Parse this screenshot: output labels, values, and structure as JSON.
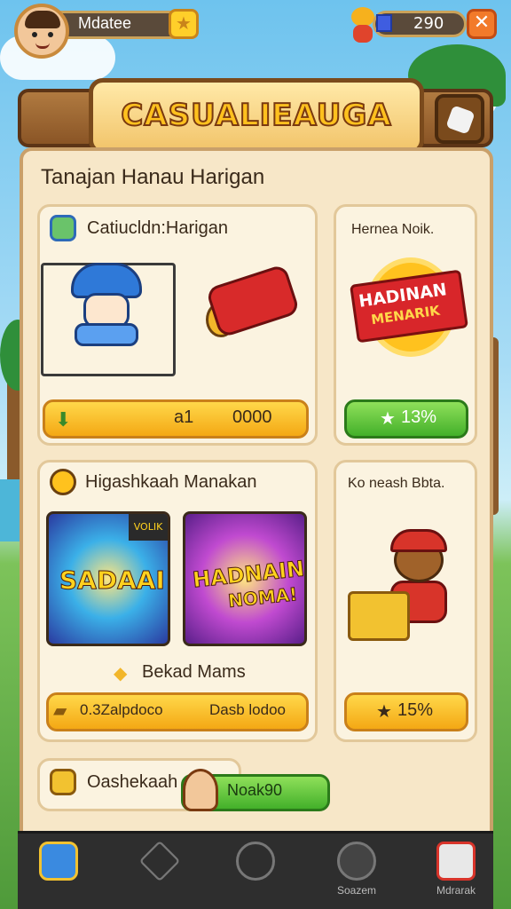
{
  "header": {
    "player_name": "Mdatee",
    "coin_value": "290",
    "title": "CASUALIEAUGA"
  },
  "section": {
    "heading": "Tanajan Hanau Harigan"
  },
  "cards": {
    "c1": {
      "title": "Catiucldn:Harigan",
      "btn_left": "a1",
      "btn_right": "0000"
    },
    "c2": {
      "title": "Hernea Noik.",
      "badge_line1": "HADINAN",
      "badge_line2": "MENARIK",
      "btn": "13%"
    },
    "c3": {
      "title": "Higashkaah Manakan",
      "poster_a": "SADAAI",
      "poster_a_corner": "VOLIK",
      "poster_b_line1": "HADNAIN",
      "poster_b_line2": "NOMA!",
      "sub_label": "Bekad Mams",
      "btn_left": "0.3Zalpdoco",
      "btn_right": "Dasb lodoo"
    },
    "c4": {
      "title": "Ko neash Bbta.",
      "btn": "15%"
    },
    "c5": {
      "title": "Oashekaah",
      "btn": "Noak90"
    }
  },
  "nav": {
    "items": [
      {
        "label": "",
        "icon": "home-icon"
      },
      {
        "label": "",
        "icon": "diamond-icon"
      },
      {
        "label": "",
        "icon": "tools-icon"
      },
      {
        "label": "Soazem",
        "icon": "coin-icon"
      },
      {
        "label": "Mdrarak",
        "icon": "close-icon"
      }
    ]
  },
  "colors": {
    "accent_yellow": "#ffcf2a",
    "accent_green": "#43b02a",
    "panel": "#f7e7c8",
    "wood": "#8a5526"
  }
}
